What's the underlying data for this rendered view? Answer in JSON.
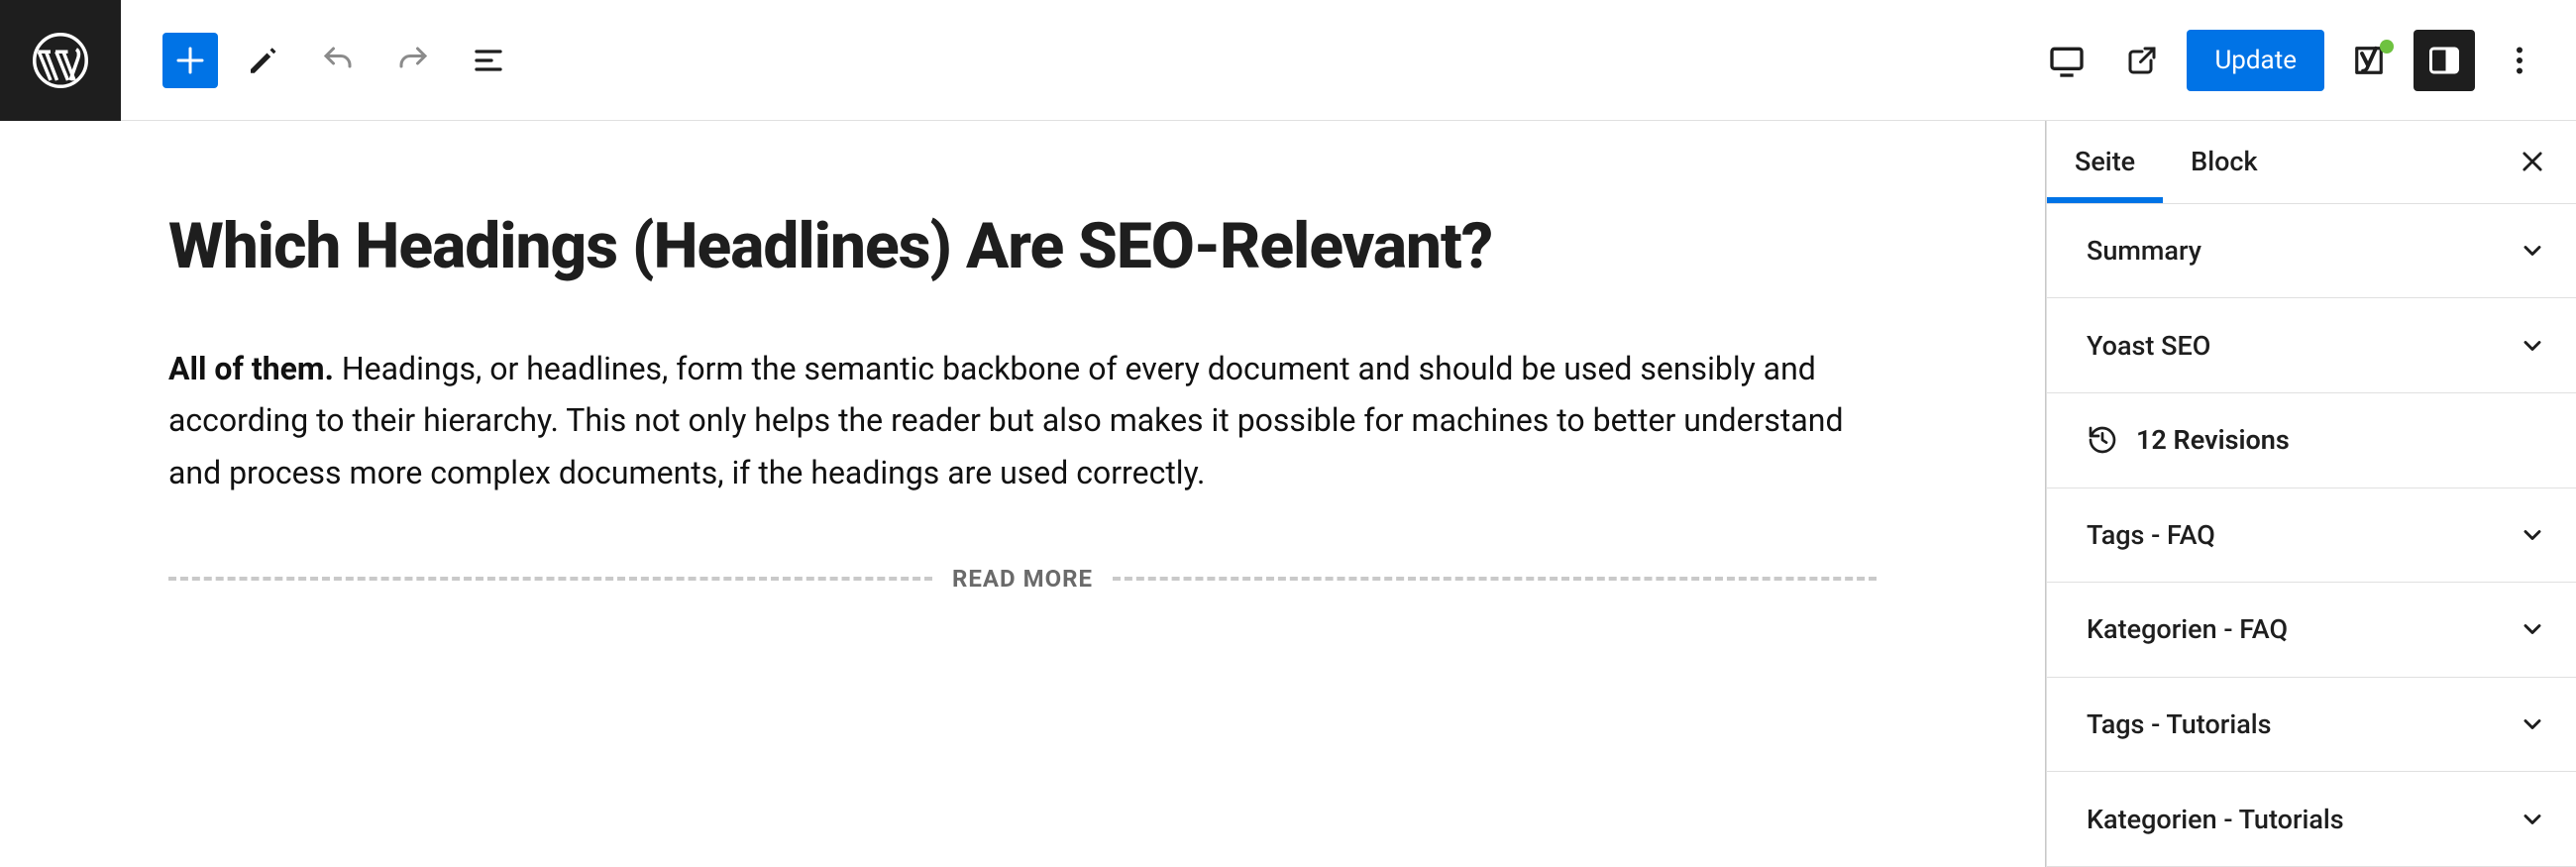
{
  "toolbar": {
    "update_label": "Update"
  },
  "editor": {
    "post_title": "Which Headings (Headlines) Are SEO-Relevant?",
    "paragraph_strong": "All of them.",
    "paragraph_rest": " Headings, or headlines, form the semantic backbone of every document and should be used sensibly and according to their hierarchy. This not only helps the reader but also makes it possible for machines to better understand and process more complex documents, if the headings are used correctly.",
    "read_more_label": "READ MORE"
  },
  "sidebar": {
    "tabs": {
      "seite": "Seite",
      "block": "Block"
    },
    "panels": {
      "summary": "Summary",
      "yoast": "Yoast SEO",
      "revisions": "12 Revisions",
      "tags_faq": "Tags - FAQ",
      "kategorien_faq": "Kategorien - FAQ",
      "tags_tutorials": "Tags - Tutorials",
      "kategorien_tutorials": "Kategorien - Tutorials"
    }
  }
}
